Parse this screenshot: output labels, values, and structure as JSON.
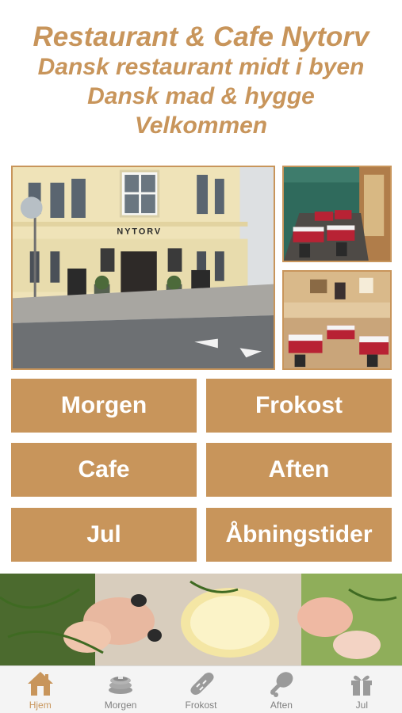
{
  "header": {
    "title": "Restaurant & Cafe Nytorv",
    "subtitle1": "Dansk restaurant midt i byen",
    "subtitle2": "Dansk mad & hygge",
    "subtitle3": "Velkommen"
  },
  "photos": {
    "facade_sign": "NYTORV"
  },
  "menu": {
    "morgen": "Morgen",
    "frokost": "Frokost",
    "cafe": "Cafe",
    "aften": "Aften",
    "jul": "Jul",
    "abningstider": "Åbningstider"
  },
  "tabs": [
    {
      "label": "Hjem",
      "icon": "house-icon",
      "active": true
    },
    {
      "label": "Morgen",
      "icon": "pancakes-icon",
      "active": false
    },
    {
      "label": "Frokost",
      "icon": "bread-icon",
      "active": false
    },
    {
      "label": "Aften",
      "icon": "drumstick-icon",
      "active": false
    },
    {
      "label": "Jul",
      "icon": "gift-icon",
      "active": false
    }
  ],
  "colors": {
    "accent": "#c8955b",
    "tab_inactive": "#808080",
    "tabbar_bg": "#f4f4f4"
  }
}
